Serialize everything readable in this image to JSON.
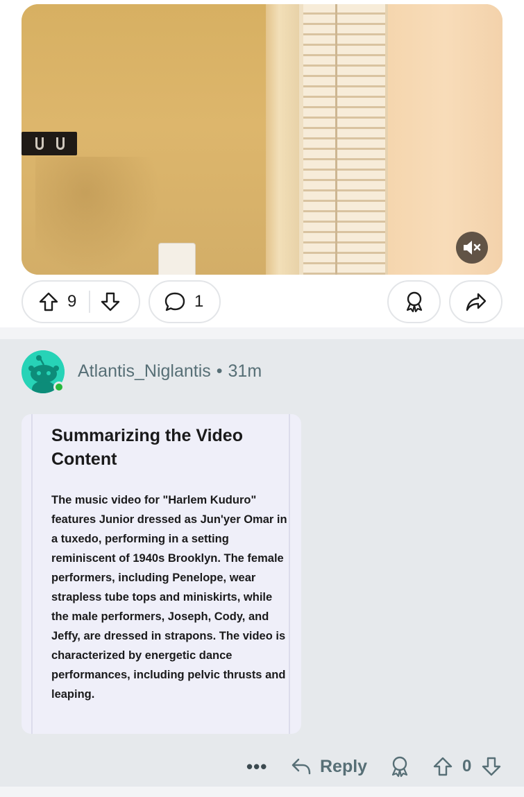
{
  "video": {
    "mute_icon": "speaker-muted-icon"
  },
  "post_actions": {
    "upvote_icon": "arrow-up-icon",
    "vote_count": "9",
    "downvote_icon": "arrow-down-icon",
    "comment_icon": "speech-bubble-icon",
    "comment_count": "1",
    "award_icon": "award-ribbon-icon",
    "share_icon": "share-arrow-icon"
  },
  "comment": {
    "username": "Atlantis_Niglantis",
    "separator": "•",
    "time_ago": "31m",
    "title": "Summarizing the Video Content",
    "body": "The music video for \"Harlem Kuduro\" features Junior dressed as Jun'yer Omar in a tuxedo, performing in a setting reminiscent of 1940s Brooklyn. The female performers, including Penelope, wear strapless tube tops and miniskirts, while the male performers, Joseph, Cody, and Jeffy, are dressed in strapons. The video is characterized by energetic dance performances, including pelvic thrusts and leaping.",
    "actions": {
      "more_label": "•••",
      "reply_label": "Reply",
      "vote_count": "0"
    }
  },
  "colors": {
    "accent_online": "#28b83c",
    "avatar_bg": "#27d3b7",
    "comment_bg": "#e6e9ec",
    "card_bg": "#efeff9"
  }
}
